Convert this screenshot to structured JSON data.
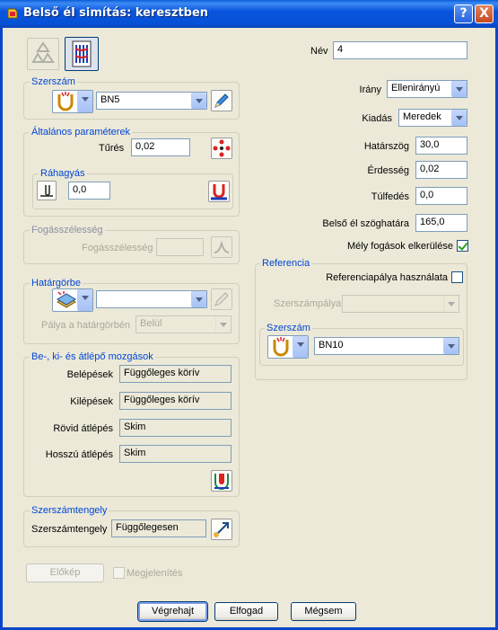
{
  "window": {
    "title": "Belső él simítás: keresztben",
    "help_btn": "?",
    "close_btn": "X"
  },
  "name": {
    "label": "Név",
    "value": "4"
  },
  "tool_group": {
    "title": "Szerszám",
    "tool_value": "BN5"
  },
  "general": {
    "title": "Általános paraméterek",
    "tolerance_label": "Tűrés",
    "tolerance_value": "0,02",
    "allowance_title": "Ráhagyás",
    "allowance_value": "0,0"
  },
  "stepover": {
    "title": "Fogásszélesség",
    "label": "Fogásszélesség",
    "value": ""
  },
  "boundary": {
    "title": "Határgörbe",
    "value": "",
    "path_label": "Pálya a határgörbén",
    "path_value": "Belül"
  },
  "moves": {
    "title": "Be-, ki- és átlépő mozgások",
    "rows": [
      {
        "label": "Belépések",
        "value": "Függőleges körív"
      },
      {
        "label": "Kilépések",
        "value": "Függőleges körív"
      },
      {
        "label": "Rövid átlépés",
        "value": "Skim"
      },
      {
        "label": "Hosszú átlépés",
        "value": "Skim"
      }
    ]
  },
  "axis": {
    "title": "Szerszámtengely",
    "label": "Szerszámtengely",
    "value": "Függőlegesen"
  },
  "preview": {
    "button": "Előkép",
    "checkbox_label": "Megjelenítés"
  },
  "right": {
    "direction_label": "Irány",
    "direction_value": "Ellenirányú",
    "output_label": "Kiadás",
    "output_value": "Meredek",
    "threshold_label": "Határszög",
    "threshold_value": "30,0",
    "roughness_label": "Érdesség",
    "roughness_value": "0,02",
    "overlap_label": "Túlfedés",
    "overlap_value": "0,0",
    "corner_label": "Belső él szöghatára",
    "corner_value": "165,0",
    "deep_label": "Mély fogások elkerülése",
    "reference": {
      "title": "Referencia",
      "use_label": "Referenciapálya használata",
      "toolpath_label": "Szerszámpálya",
      "toolpath_value": "",
      "tool_title": "Szerszám",
      "tool_value": "BN10"
    }
  },
  "footer": {
    "execute": "Végrehajt",
    "accept": "Elfogad",
    "cancel": "Mégsem"
  },
  "colors": {
    "title_bar": "#0a5fd8",
    "group_title": "#0046d5",
    "dialog_bg": "#ece9d8"
  }
}
